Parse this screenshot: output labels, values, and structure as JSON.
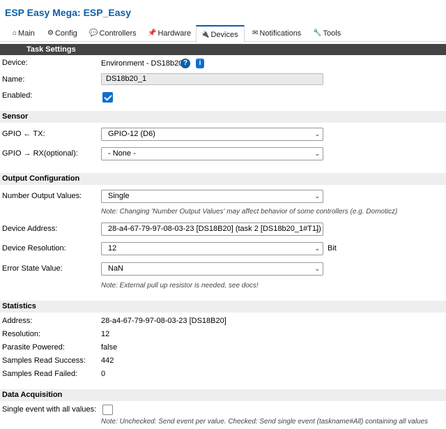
{
  "app": {
    "title": "ESP Easy Mega: ESP_Easy"
  },
  "tabs": [
    {
      "label": "Main",
      "icon": "home-icon",
      "glyph": "⌂"
    },
    {
      "label": "Config",
      "icon": "gear-icon",
      "glyph": "⚙"
    },
    {
      "label": "Controllers",
      "icon": "chat-icon",
      "glyph": "💬"
    },
    {
      "label": "Hardware",
      "icon": "pin-icon",
      "glyph": "📌"
    },
    {
      "label": "Devices",
      "icon": "plug-icon",
      "glyph": "🔌"
    },
    {
      "label": "Notifications",
      "icon": "envelope-icon",
      "glyph": "✉"
    },
    {
      "label": "Tools",
      "icon": "wrench-icon",
      "glyph": "🔧"
    }
  ],
  "active_tab": "Devices",
  "task_settings": {
    "header": "Task Settings",
    "device_label": "Device:",
    "device_value": "Environment - DS18b20",
    "help_q": "?",
    "help_i": "i",
    "name_label": "Name:",
    "name_value": "DS18b20_1",
    "enabled_label": "Enabled:",
    "enabled": true
  },
  "sensor": {
    "header": "Sensor",
    "gpio_tx_label": "GPIO ← TX:",
    "gpio_tx_value": "GPIO-12 (D6)",
    "gpio_rx_label": "GPIO → RX(optional):",
    "gpio_rx_value": "- None -"
  },
  "output": {
    "header": "Output Configuration",
    "num_values_label": "Number Output Values:",
    "num_values_value": "Single",
    "num_values_note": "Note: Changing 'Number Output Values' may affect behavior of some controllers (e.g. Domoticz)",
    "address_label": "Device Address:",
    "address_value": "28-a4-67-79-97-08-03-23 [DS18B20] (task 2 [DS18b20_1#T1])",
    "resolution_label": "Device Resolution:",
    "resolution_value": "12",
    "resolution_unit": "Bit",
    "error_label": "Error State Value:",
    "error_value": "NaN",
    "error_note": "Note: External pull up resistor is needed, see docs!"
  },
  "statistics": {
    "header": "Statistics",
    "rows": [
      {
        "label": "Address:",
        "value": "28-a4-67-79-97-08-03-23 [DS18B20]"
      },
      {
        "label": "Resolution:",
        "value": "12"
      },
      {
        "label": "Parasite Powered:",
        "value": "false"
      },
      {
        "label": "Samples Read Success:",
        "value": "442"
      },
      {
        "label": "Samples Read Failed:",
        "value": "0"
      }
    ]
  },
  "data_acquisition": {
    "header": "Data Acquisition",
    "single_event_label": "Single event with all values:",
    "single_event_checked": false,
    "single_event_note": "Note: Unchecked: Send event per value. Checked: Send single event (taskname#All) containing all values"
  }
}
